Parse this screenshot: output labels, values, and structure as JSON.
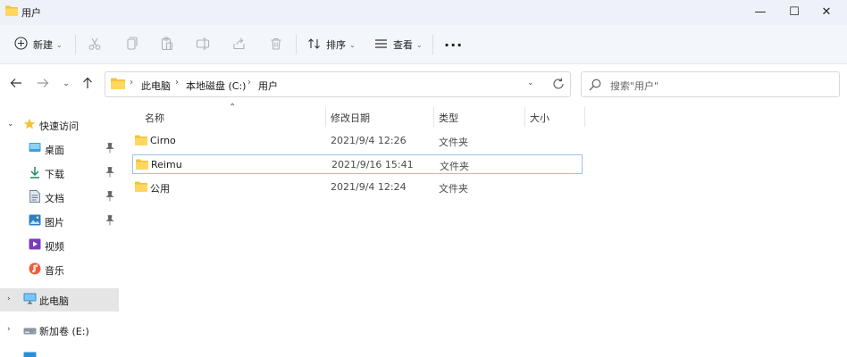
{
  "window": {
    "title": "用户",
    "controls": {
      "minimize": "—",
      "maximize": "☐",
      "close": "✕"
    }
  },
  "toolbar": {
    "new_label": "新建",
    "sort_label": "排序",
    "view_label": "查看",
    "more_label": "···",
    "actions": [
      "scissors-icon",
      "copy-icon",
      "paste-icon",
      "rename-icon",
      "share-icon",
      "trash-icon"
    ]
  },
  "address": {
    "crumbs": [
      "此电脑",
      "本地磁盘 (C:)",
      "用户"
    ],
    "separator": "›"
  },
  "search": {
    "placeholder": "搜索\"用户\""
  },
  "nav": {
    "quick_access": "快速访问",
    "items": [
      {
        "label": "桌面",
        "icon": "desktop-icon",
        "pinned": true
      },
      {
        "label": "下载",
        "icon": "download-icon",
        "pinned": true
      },
      {
        "label": "文档",
        "icon": "document-icon",
        "pinned": true
      },
      {
        "label": "图片",
        "icon": "picture-icon",
        "pinned": true
      },
      {
        "label": "视频",
        "icon": "video-icon",
        "pinned": false
      },
      {
        "label": "音乐",
        "icon": "music-icon",
        "pinned": false
      }
    ],
    "this_pc": "此电脑",
    "drive": "新加卷 (E:)"
  },
  "columns": {
    "name": "名称",
    "modified": "修改日期",
    "type": "类型",
    "size": "大小"
  },
  "files": [
    {
      "name": "Cirno",
      "modified": "2021/9/4 12:26",
      "type": "文件夹"
    },
    {
      "name": "Reimu",
      "modified": "2021/9/16 15:41",
      "type": "文件夹"
    },
    {
      "name": "公用",
      "modified": "2021/9/4 12:24",
      "type": "文件夹"
    }
  ],
  "colors": {
    "folder": "#f3c33a",
    "accent": "#0067c0",
    "selection": "#e5e5e5",
    "focus_border": "#99c4e8"
  }
}
